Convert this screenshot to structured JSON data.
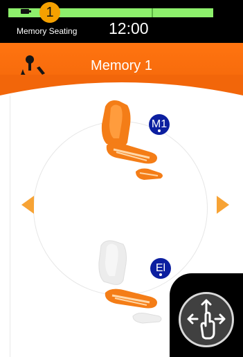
{
  "status_bar": {
    "app_name": "Memory Seating",
    "time": "12:00",
    "notification_count": "1",
    "icons": [
      "battery-icon"
    ]
  },
  "header": {
    "title": "Memory 1",
    "icon": "seat-adjust-icon"
  },
  "positions": [
    {
      "label": "M1",
      "icon": "seat-icon"
    },
    {
      "label": "El",
      "icon": "seat-icon"
    }
  ],
  "navigation": {
    "left_icon": "arrow-left-icon",
    "right_icon": "arrow-right-icon"
  },
  "touch_control": {
    "icon": "swipe-gesture-icon"
  },
  "colors": {
    "accent_orange": "#f2660a",
    "status_green": "#8df06c",
    "badge_yellow": "#f5a000",
    "memory_blue": "#0c1fa0"
  }
}
